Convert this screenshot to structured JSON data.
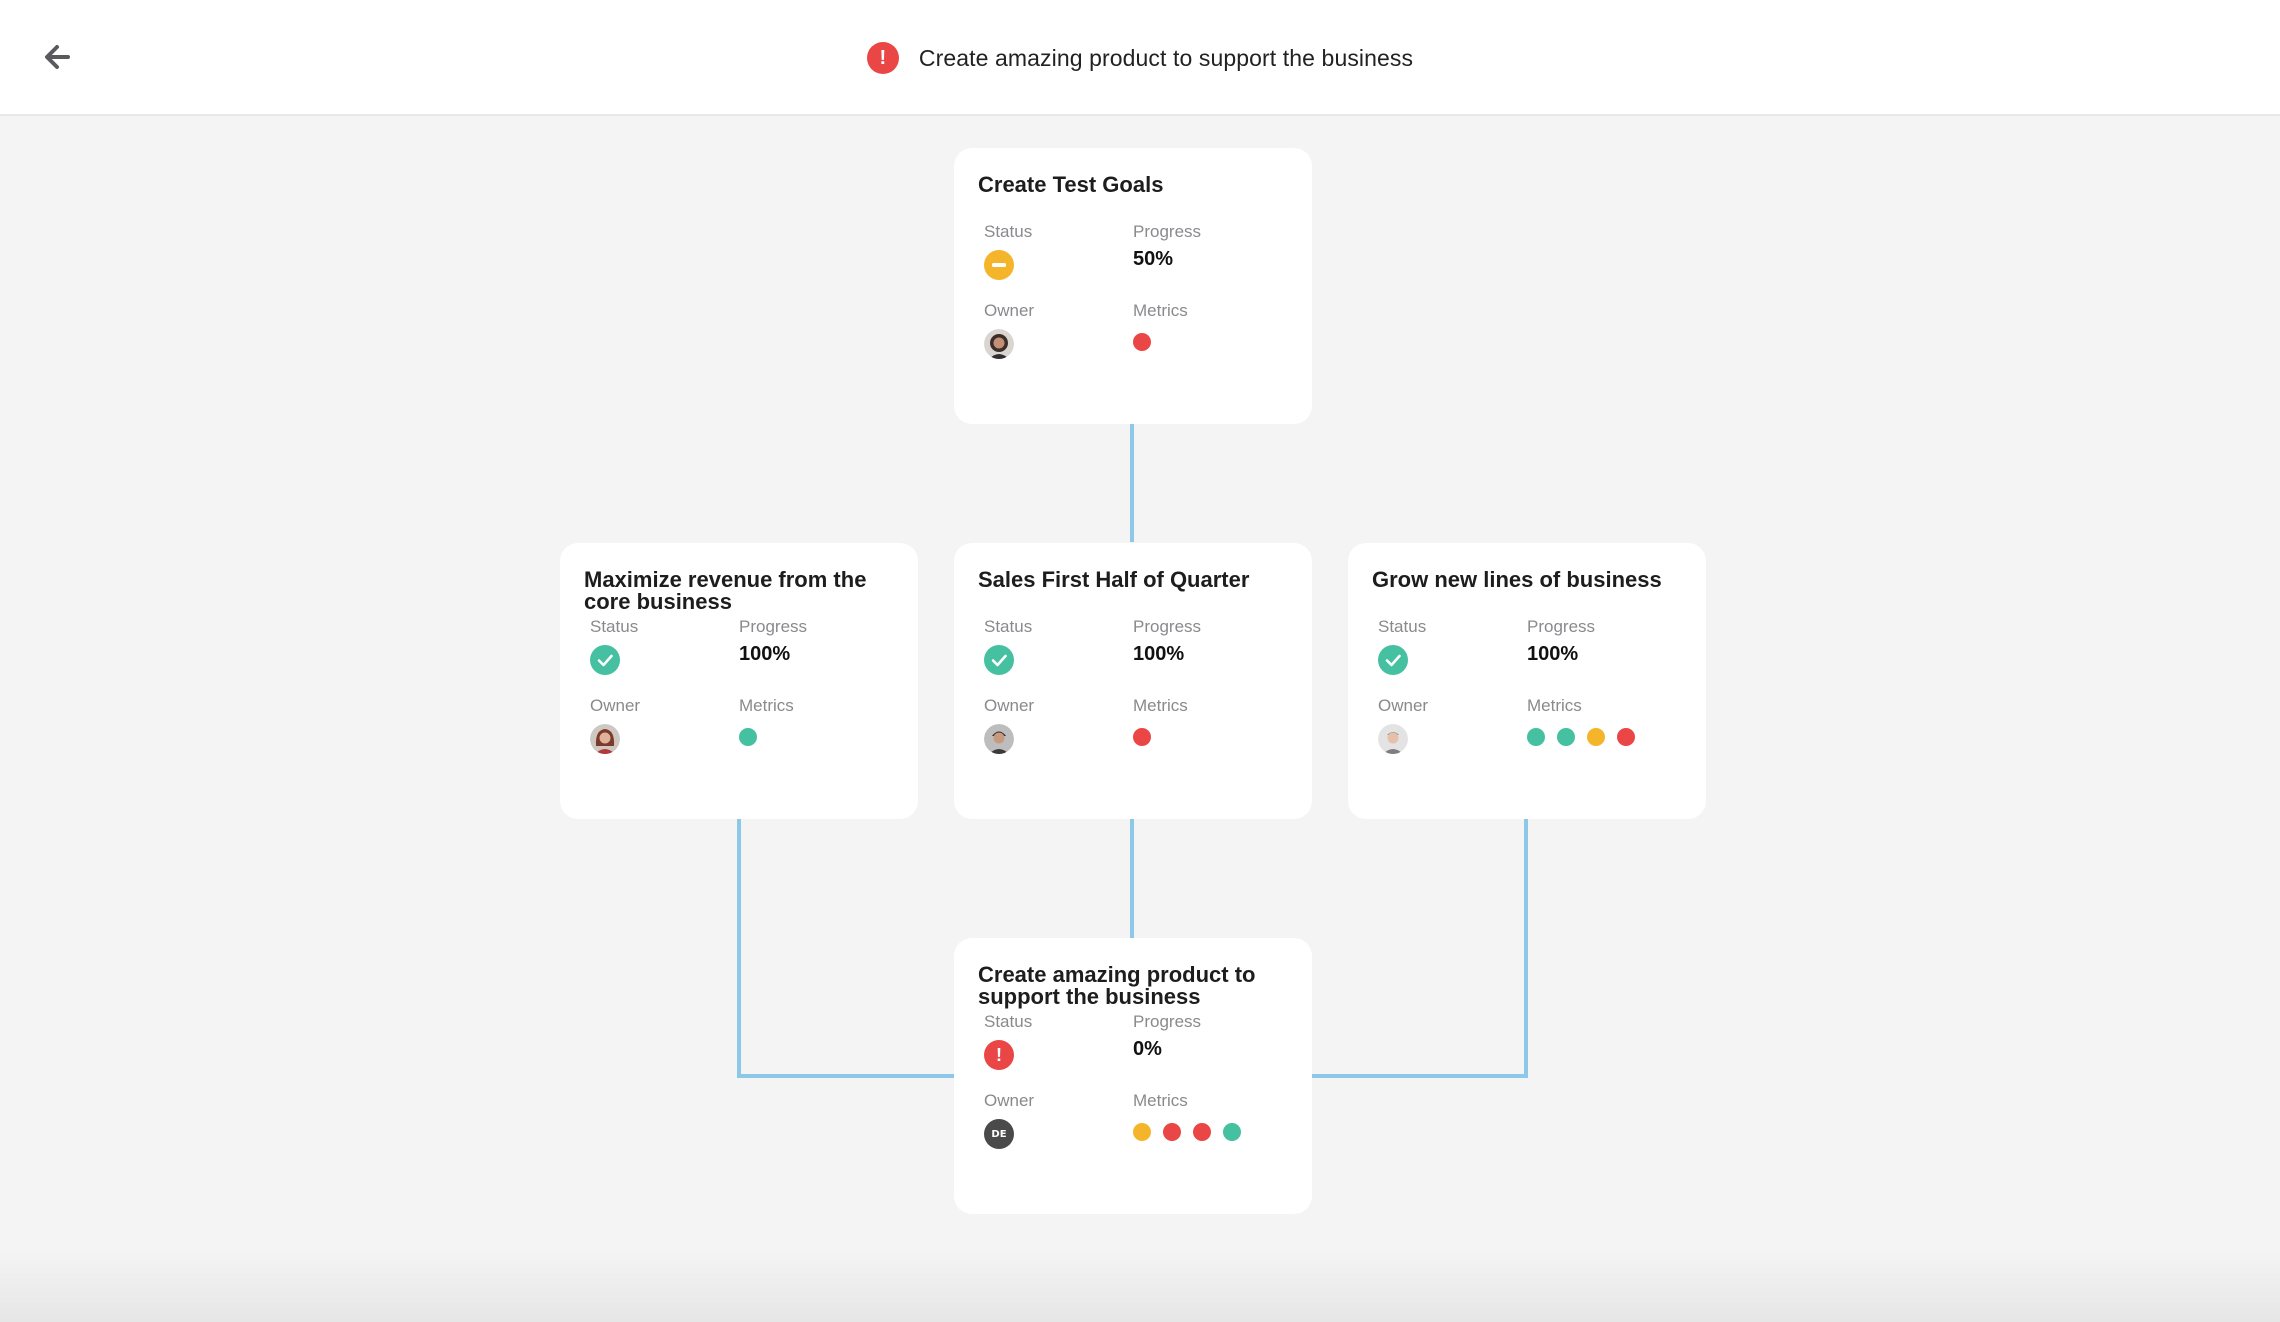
{
  "header": {
    "back_icon": "arrow-left-icon",
    "status_icon": "alert-icon",
    "status_symbol": "!",
    "title": "Create amazing product to support the business"
  },
  "colors": {
    "complete": "#45c0a1",
    "partial": "#f5b52b",
    "alert": "#ea4646",
    "connector": "#8ec8e8"
  },
  "labels": {
    "status": "Status",
    "progress": "Progress",
    "owner": "Owner",
    "metrics": "Metrics"
  },
  "goals": [
    {
      "title": "Create Test Goals",
      "status": "partial",
      "progress": "50%",
      "owner_icon": "person-avatar",
      "metrics": [
        "red"
      ]
    },
    {
      "title": "Maximize revenue from the core business",
      "status": "complete",
      "progress": "100%",
      "owner_icon": "person-avatar",
      "metrics": [
        "green"
      ]
    },
    {
      "title": "Sales First Half of Quarter",
      "status": "complete",
      "progress": "100%",
      "owner_icon": "person-avatar",
      "metrics": [
        "red"
      ]
    },
    {
      "title": "Grow new lines of business",
      "status": "complete",
      "progress": "100%",
      "owner_icon": "person-avatar",
      "metrics": [
        "green",
        "green",
        "yellow",
        "red"
      ]
    },
    {
      "title": "Create amazing product to support the business",
      "status": "alert",
      "progress": "0%",
      "owner_initials": "DE",
      "metrics": [
        "yellow",
        "red",
        "red",
        "green"
      ]
    }
  ]
}
